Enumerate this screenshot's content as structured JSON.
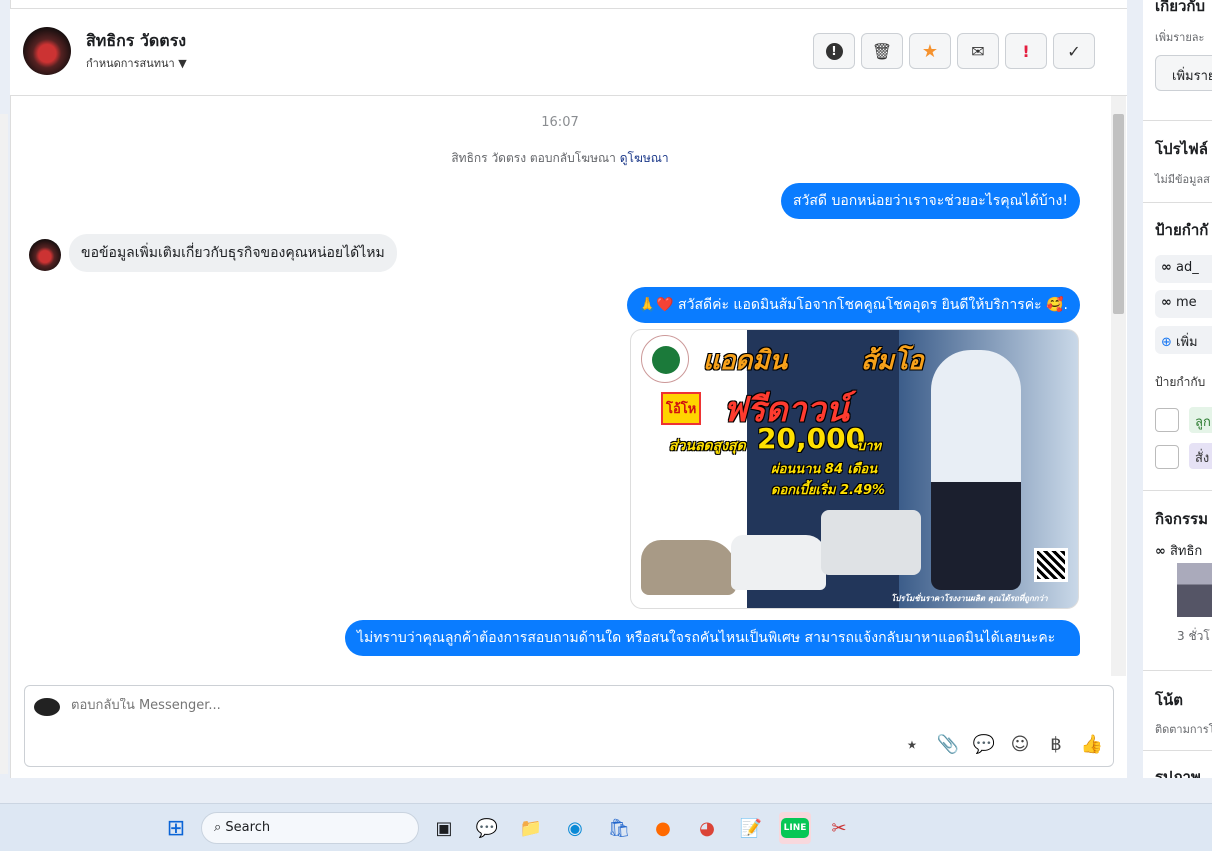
{
  "header": {
    "name": "สิทธิกร วัดตรง",
    "subtitle": "กำหนดการสนทนา",
    "actions": [
      "alert-icon",
      "trash-icon",
      "star-icon",
      "envelope-icon",
      "exclamation-icon",
      "check-icon"
    ]
  },
  "chat": {
    "timestamp": "16:07",
    "ad_reply_text": "สิทธิกร วัดตรง ตอบกลับโฆษณา",
    "ad_reply_link": "ดูโฆษณา",
    "messages": [
      {
        "dir": "out",
        "text": "สวัสดี บอกหน่อยว่าเราจะช่วยอะไรคุณได้บ้าง!"
      },
      {
        "dir": "in",
        "text": "ขอข้อมูลเพิ่มเติมเกี่ยวกับธุรกิจของคุณหน่อยได้ไหม"
      },
      {
        "dir": "out",
        "text": "🙏❤️ สวัสดีค่ะ แอดมินส้มโอจากโชคคูณโชคอุดร ยินดีให้บริการค่ะ 🥰."
      },
      {
        "dir": "out",
        "text": "ไม่ทราบว่าคุณลูกค้าต้องการสอบถามด้านใด หรือสนใจรถคันไหนเป็นพิเศษ สามารถแจ้งกลับมาหาแอดมินได้เลยนะคะ"
      }
    ],
    "ad_image": {
      "title1": "แอดมิน",
      "title2": "ส้มโอ",
      "burst": "โอ้โห",
      "headline": "ฟรีดาวน์",
      "discount_label": "ส่วนลดสูงสุด",
      "discount_value": "20,000",
      "currency": "บาท",
      "installment": "ผ่อนนาน 84 เดือน",
      "interest": "ดอกเบี้ยเริ่ม 2.49%",
      "footer": "โปรโมชั่นราคาโรงงานผลิต คุณได้รถที่ถูกกว่า"
    }
  },
  "compose": {
    "placeholder": "ตอบกลับใน Messenger...",
    "icons": [
      "saved-reply-icon",
      "attachment-icon",
      "chat-dots-icon",
      "emoji-icon",
      "baht-icon",
      "like-icon"
    ]
  },
  "right_panel": {
    "about_title": "เกี่ยวกับ",
    "about_sub": "เพิ่มรายละ",
    "about_button": "เพิ่มราย",
    "profile_title": "โปรไฟล์",
    "profile_sub": "ไม่มีข้อมูลส",
    "labels_title": "ป้ายกำกั",
    "label_chips": [
      "ad_",
      "me"
    ],
    "add_label": "เพิ่ม",
    "labels_sub": "ป้ายกำกับ",
    "checkbox_labels": [
      "ลูก",
      "สั่ง"
    ],
    "activity_title": "กิจกรรม",
    "activity_item": "สิทธิก",
    "activity_time": "3 ชั่วโ",
    "notes_title": "โน้ต",
    "notes_sub": "ติดตามการโ",
    "photos_title": "รูปภาพ"
  },
  "taskbar": {
    "search_label": "Search"
  }
}
